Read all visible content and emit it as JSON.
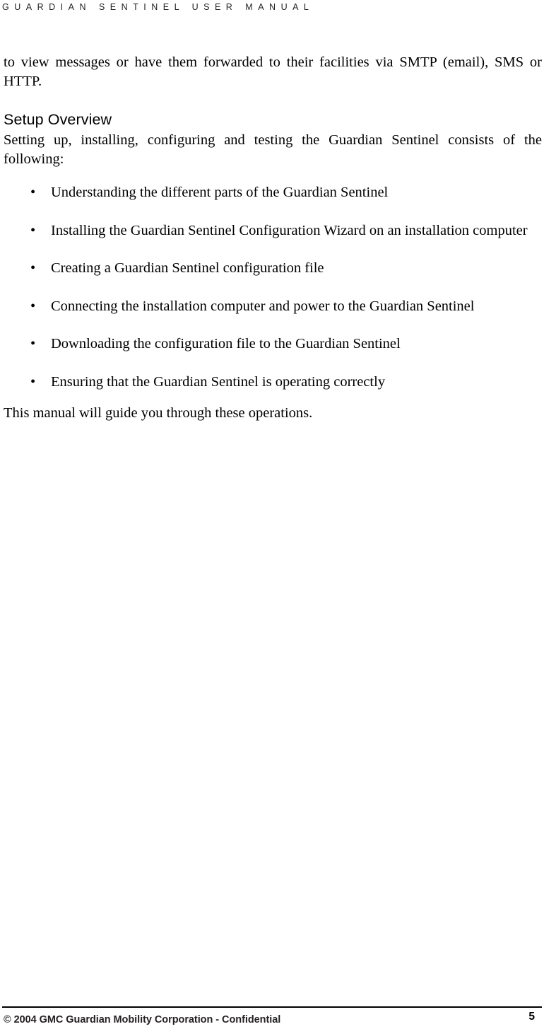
{
  "header": {
    "running_title": "GUARDIAN SENTINEL USER MANUAL"
  },
  "body": {
    "intro_paragraph": "to view messages or have them forwarded to their facilities via SMTP (email), SMS or HTTP.",
    "section_heading": "Setup Overview",
    "section_intro": "Setting up, installing, configuring and testing the Guardian Sentinel consists of the following:",
    "bullet_marker": "•",
    "bullets": [
      {
        "text": "Understanding the different parts of the Guardian Sentinel"
      },
      {
        "text": "Installing the Guardian Sentinel Configuration Wizard on an installation computer"
      },
      {
        "text": "Creating  a Guardian Sentinel configuration file"
      },
      {
        "text": "Connecting the installation computer and power to the Guardian Sentinel"
      },
      {
        "text": "Downloading the configuration file to the Guardian Sentinel"
      },
      {
        "text": "Ensuring that the Guardian Sentinel is operating correctly"
      }
    ],
    "closing_paragraph": "This manual will guide you through these operations."
  },
  "footer": {
    "copyright": "© 2004 GMC Guardian Mobility Corporation - Confidential",
    "page_number": "5"
  }
}
